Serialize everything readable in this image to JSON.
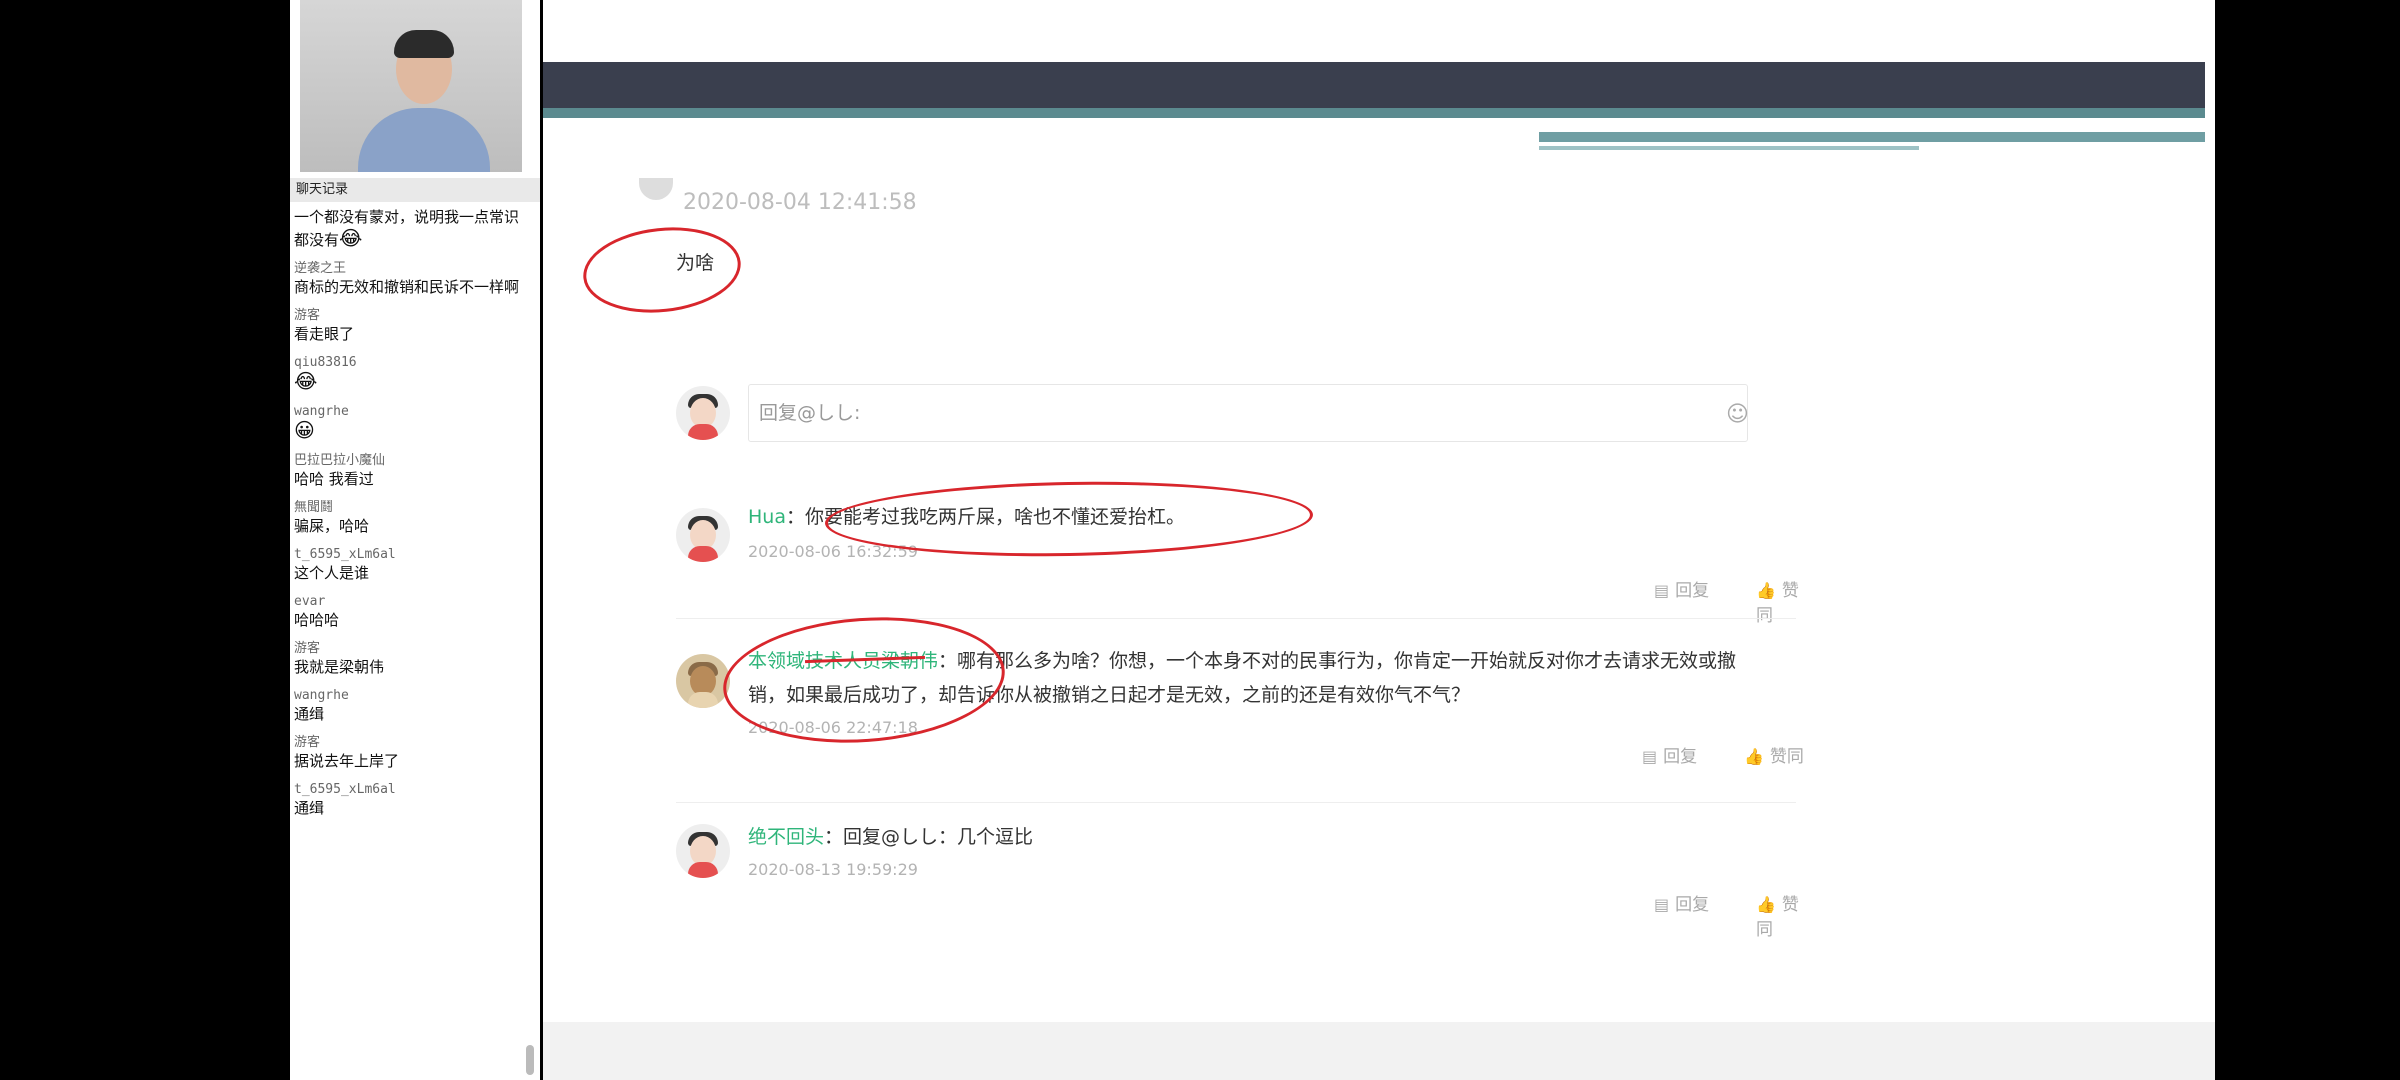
{
  "chat": {
    "header": "聊天记录",
    "messages": [
      {
        "user": "",
        "text": "一个都没有蒙对，说明我一点常识都没有",
        "emoji": "😂"
      },
      {
        "user": "逆袭之王",
        "text": "商标的无效和撤销和民诉不一样啊"
      },
      {
        "user": "游客",
        "text": "看走眼了"
      },
      {
        "user": "qiu83816",
        "text": "",
        "emoji": "😂"
      },
      {
        "user": "wangrhe",
        "text": "",
        "emoji": "😀"
      },
      {
        "user": "巴拉巴拉小魔仙",
        "text": "哈哈 我看过"
      },
      {
        "user": "無聞鬪",
        "text": "骗屎，哈哈"
      },
      {
        "user": "t_6595_xLm6al",
        "text": "这个人是谁"
      },
      {
        "user": "evar",
        "text": "哈哈哈"
      },
      {
        "user": "游客",
        "text": "我就是梁朝伟"
      },
      {
        "user": "wangrhe",
        "text": "通缉"
      },
      {
        "user": "游客",
        "text": "据说去年上岸了"
      },
      {
        "user": "t_6595_xLm6al",
        "text": "通缉"
      }
    ]
  },
  "post": {
    "timestamp": "2020-08-04 12:41:58",
    "text": "为啥"
  },
  "reply_box": {
    "placeholder": "回复@しし:",
    "emoji_icon": "smile-icon"
  },
  "comments": [
    {
      "author": "Hua",
      "text": "你要能考过我吃两斤屎，啥也不懂还爱抬杠。",
      "time": "2020-08-06 16:32:59",
      "reply_label": "回复",
      "like_label": "赞同"
    },
    {
      "author": "本领域技术人员梁朝伟",
      "text": "哪有那么多为啥？你想，一个本身不对的民事行为，你肯定一开始就反对你才去请求无效或撤销，如果最后成功了，却告诉你从被撤销之日起才是无效，之前的还是有效你气不气？",
      "time": "2020-08-06 22:47:18",
      "reply_label": "回复",
      "like_label": "赞同"
    },
    {
      "author": "绝不回头",
      "text": "回复@しし：几个逗比",
      "time": "2020-08-13 19:59:29",
      "reply_label": "回复",
      "like_label": "赞同"
    }
  ],
  "colors": {
    "author": "#2fb57a",
    "annotation": "#d8262c",
    "banner": "#3a3f4e"
  }
}
